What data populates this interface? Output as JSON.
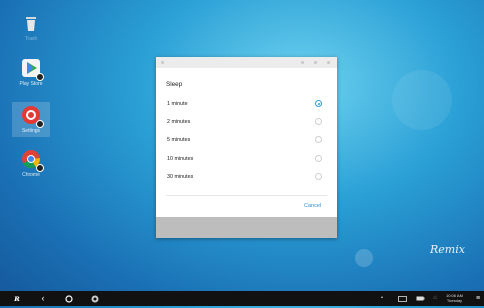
{
  "desktop": {
    "icons": [
      {
        "label": "Trash",
        "icon": "trash-icon"
      },
      {
        "label": "Play Store",
        "icon": "play-store-icon"
      },
      {
        "label": "Settings",
        "icon": "settings-icon"
      },
      {
        "label": "Chrome",
        "icon": "chrome-icon"
      }
    ],
    "brand": "Remix"
  },
  "dialog": {
    "title": "Sleep",
    "options": [
      {
        "label": "1 minute",
        "selected": true
      },
      {
        "label": "2 minutes",
        "selected": false
      },
      {
        "label": "5 minutes",
        "selected": false
      },
      {
        "label": "10 minutes",
        "selected": false
      },
      {
        "label": "30 minutes",
        "selected": false
      }
    ],
    "cancel_label": "Cancel"
  },
  "taskbar": {
    "start_icon": "remix-start-icon",
    "clock_time": "10:06 AM",
    "clock_day": "Tuesday"
  },
  "colors": {
    "accent": "#2f9fe3",
    "taskbar": "#111111"
  }
}
